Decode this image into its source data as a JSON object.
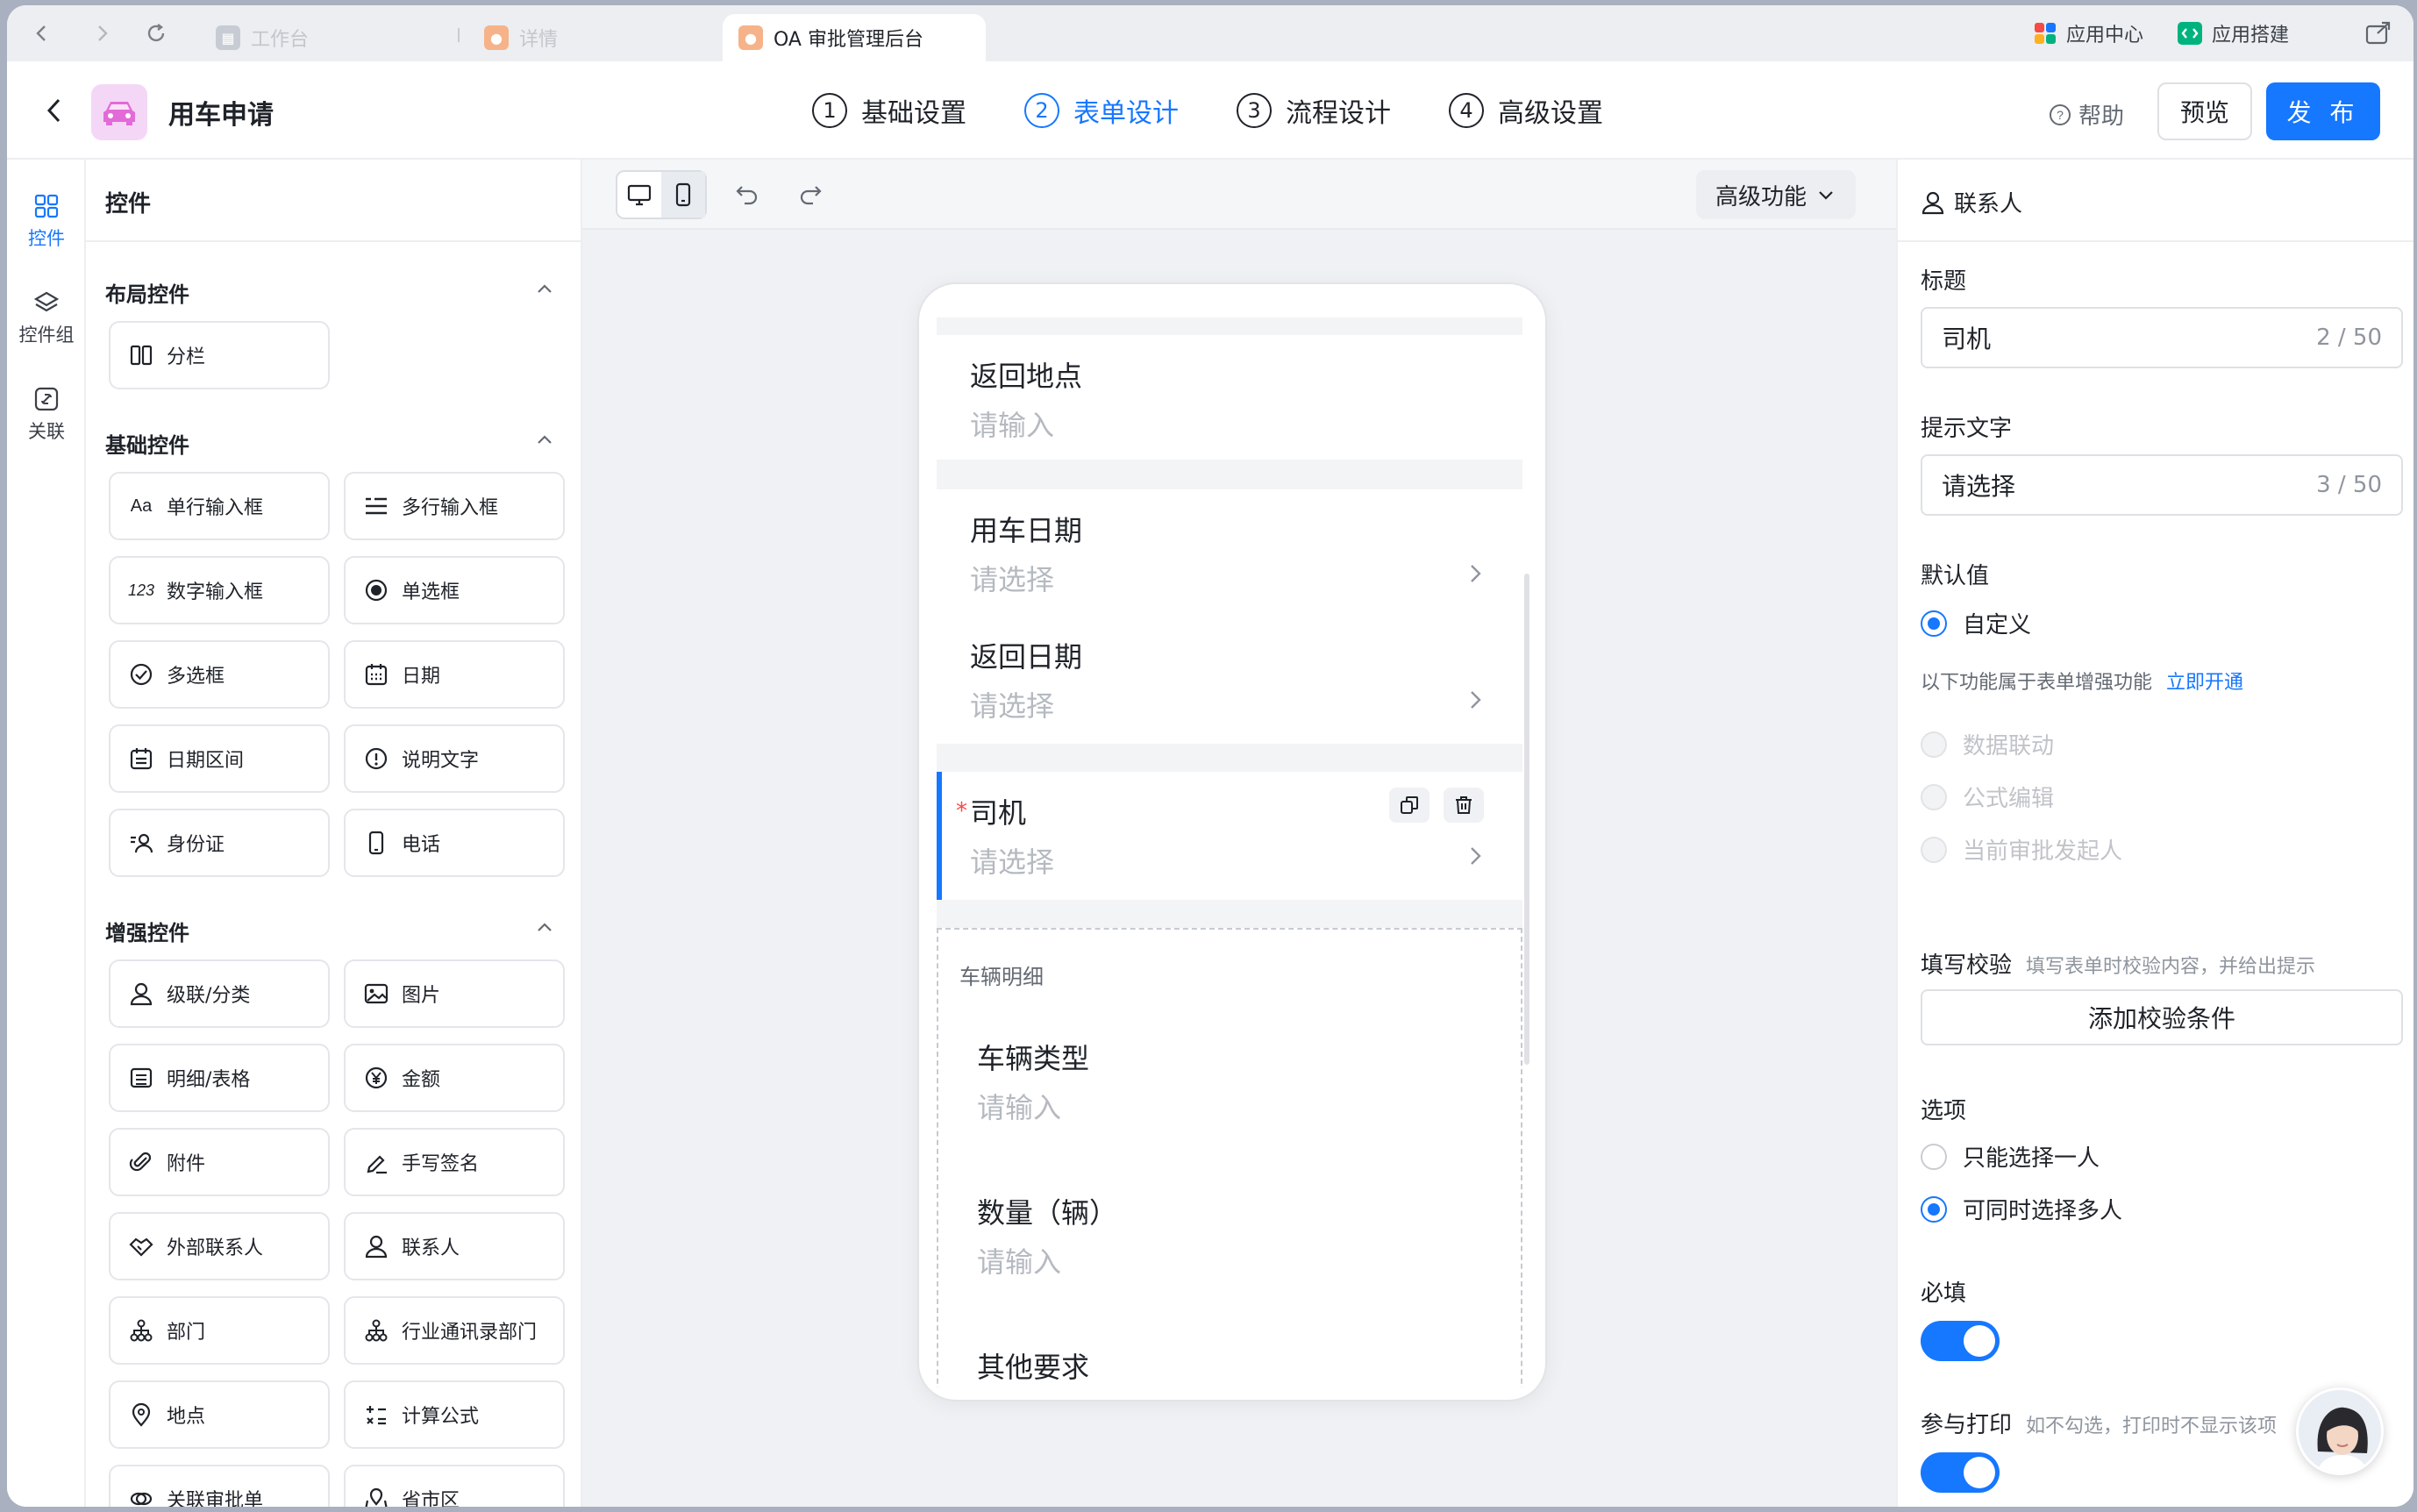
{
  "browser": {
    "tabs": [
      {
        "label": "工作台"
      },
      {
        "label": "详情"
      },
      {
        "label": "OA 审批管理后台"
      }
    ],
    "links": {
      "app_center": "应用中心",
      "app_builder": "应用搭建"
    }
  },
  "header": {
    "app_title": "用车申请",
    "steps": [
      {
        "num": "1",
        "label": "基础设置"
      },
      {
        "num": "2",
        "label": "表单设计"
      },
      {
        "num": "3",
        "label": "流程设计"
      },
      {
        "num": "4",
        "label": "高级设置"
      }
    ],
    "active_step": 2,
    "help": "帮助",
    "preview": "预览",
    "publish": "发 布"
  },
  "rail": {
    "items": [
      {
        "label": "控件",
        "icon": "grid-icon"
      },
      {
        "label": "控件组",
        "icon": "layers-icon"
      },
      {
        "label": "关联",
        "icon": "link-icon"
      }
    ]
  },
  "controls": {
    "title": "控件",
    "sections": [
      {
        "title": "布局控件",
        "items": [
          "分栏"
        ]
      },
      {
        "title": "基础控件",
        "items": [
          "单行输入框",
          "多行输入框",
          "数字输入框",
          "单选框",
          "多选框",
          "日期",
          "日期区间",
          "说明文字",
          "身份证",
          "电话"
        ]
      },
      {
        "title": "增强控件",
        "items": [
          "级联/分类",
          "图片",
          "明细/表格",
          "金额",
          "附件",
          "手写签名",
          "外部联系人",
          "联系人",
          "部门",
          "行业通讯录部门",
          "地点",
          "计算公式",
          "关联审批单",
          "省市区"
        ]
      }
    ]
  },
  "canvas": {
    "advanced": "高级功能",
    "form": {
      "return_place": {
        "label": "返回地点",
        "placeholder": "请输入"
      },
      "use_date": {
        "label": "用车日期",
        "placeholder": "请选择"
      },
      "return_date": {
        "label": "返回日期",
        "placeholder": "请选择"
      },
      "driver": {
        "label": "司机",
        "placeholder": "请选择",
        "required_mark": "*"
      },
      "vehicle_detail": {
        "title": "车辆明细",
        "type": {
          "label": "车辆类型",
          "placeholder": "请输入"
        },
        "count": {
          "label": "数量（辆）",
          "placeholder": "请输入"
        },
        "other": {
          "label": "其他要求"
        }
      }
    }
  },
  "props": {
    "component": "联系人",
    "title_label": "标题",
    "title_value": "司机",
    "title_count": "2 / 50",
    "hint_label": "提示文字",
    "hint_value": "请选择",
    "hint_count": "3 / 50",
    "default_label": "默认值",
    "default_custom": "自定义",
    "enhance_note": "以下功能属于表单增强功能",
    "enhance_link": "立即开通",
    "disabled_options": [
      "数据联动",
      "公式编辑",
      "当前审批发起人"
    ],
    "validate_label": "填写校验",
    "validate_hint": "填写表单时校验内容，并给出提示",
    "validate_button": "添加校验条件",
    "options_label": "选项",
    "option_single": "只能选择一人",
    "option_multi": "可同时选择多人",
    "required_label": "必填",
    "required_on": true,
    "print_label": "参与打印",
    "print_hint": "如不勾选，打印时不显示该项",
    "print_on": true
  },
  "colors": {
    "accent": "#1677ff",
    "required": "#f54a45"
  }
}
